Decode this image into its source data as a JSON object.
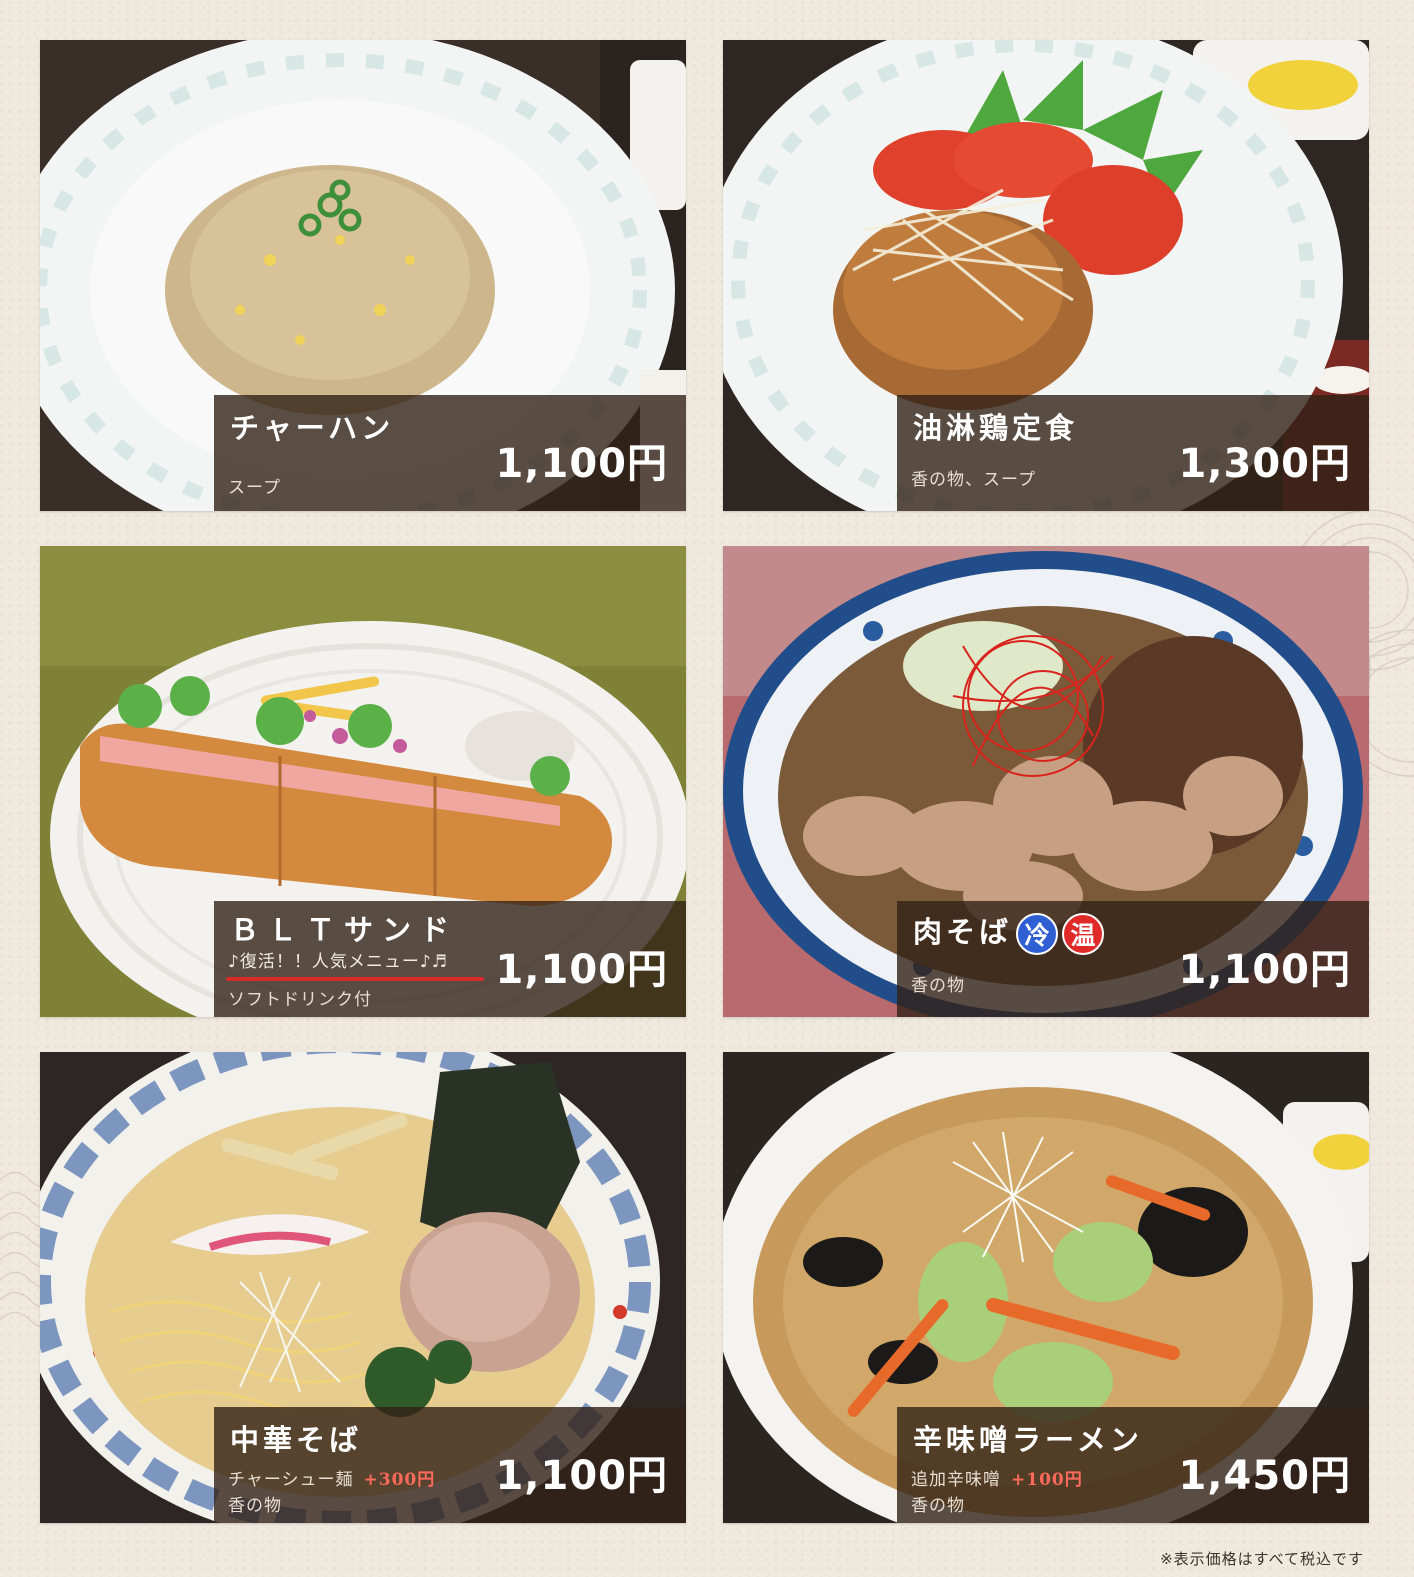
{
  "colors": {
    "panel": "#32221673",
    "accent_red": "#d72a2a",
    "cold_badge": "#2f5fd3",
    "hot_badge": "#e02a2a"
  },
  "menu": [
    {
      "name": "チャーハン",
      "tagline": "",
      "sub_lines": [
        {
          "text": "スープ",
          "extra": ""
        }
      ],
      "price": "1,100円",
      "badges": []
    },
    {
      "name": "油淋鶏定食",
      "tagline": "",
      "sub_lines": [
        {
          "text": "香の物、スープ",
          "extra": ""
        }
      ],
      "price": "1,300円",
      "badges": []
    },
    {
      "name": "ＢＬＴサンド",
      "tagline": "♪復活！！人気メニュー♪♬",
      "sub_lines": [
        {
          "text": "ソフトドリンク付",
          "extra": ""
        }
      ],
      "price": "1,100円",
      "badges": []
    },
    {
      "name": "肉そば",
      "tagline": "",
      "sub_lines": [
        {
          "text": "香の物",
          "extra": ""
        }
      ],
      "price": "1,100円",
      "badges": [
        {
          "label": "冷",
          "color": "#2f5fd3"
        },
        {
          "label": "温",
          "color": "#e02a2a"
        }
      ]
    },
    {
      "name": "中華そば",
      "tagline": "",
      "sub_lines": [
        {
          "text": "チャーシュー麺",
          "extra": "+300円"
        },
        {
          "text": "香の物",
          "extra": ""
        }
      ],
      "price": "1,100円",
      "badges": []
    },
    {
      "name": "辛味噌ラーメン",
      "tagline": "",
      "sub_lines": [
        {
          "text": "追加辛味噌",
          "extra": "+100円"
        },
        {
          "text": "香の物",
          "extra": ""
        }
      ],
      "price": "1,450円",
      "badges": []
    }
  ],
  "footer_note": "※表示価格はすべて税込です"
}
